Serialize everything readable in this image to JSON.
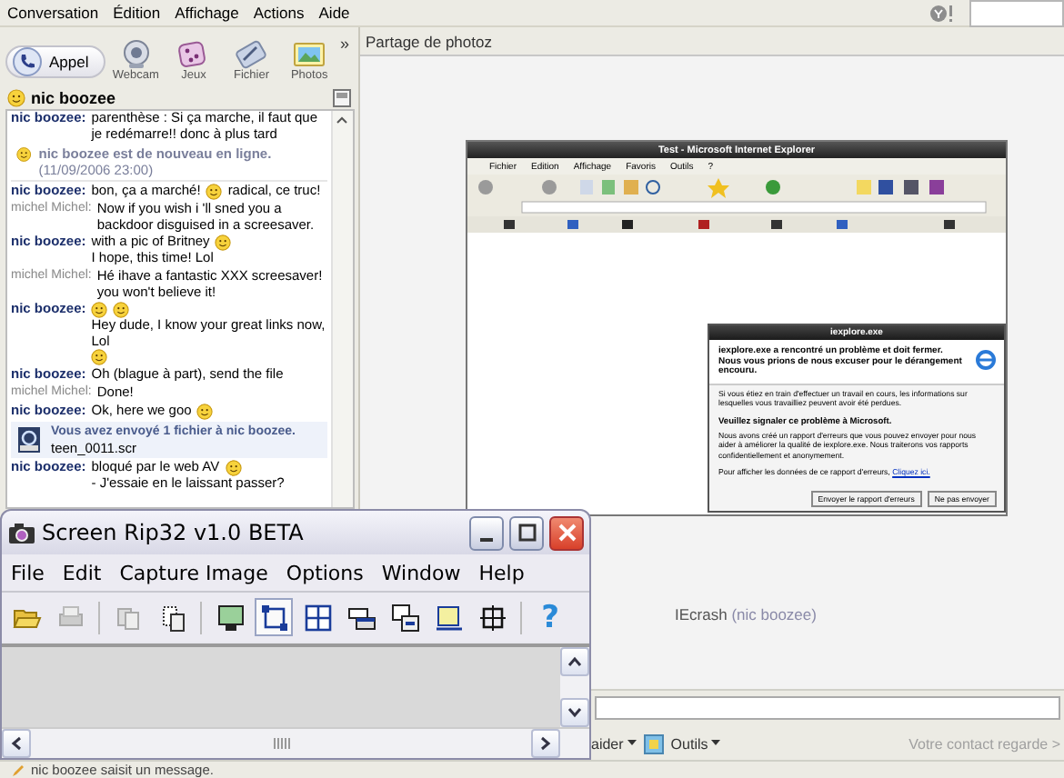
{
  "menu": [
    "Conversation",
    "Édition",
    "Affichage",
    "Actions",
    "Aide"
  ],
  "toolbar": [
    {
      "kind": "call",
      "label": "Appel"
    },
    {
      "kind": "webcam",
      "label": "Webcam"
    },
    {
      "kind": "games",
      "label": "Jeux"
    },
    {
      "kind": "file",
      "label": "Fichier"
    },
    {
      "kind": "photos",
      "label": "Photos"
    }
  ],
  "toolbar_more": "»",
  "contact": {
    "name": "nic boozee"
  },
  "chat": [
    {
      "kind": "contact",
      "sender": "nic boozee:",
      "parts": [
        {
          "kind": "text",
          "text": "parenthèse : Si ça marche, il faut que je redémarre!! donc à plus tard"
        }
      ]
    },
    {
      "kind": "status",
      "text": "nic boozee est de nouveau en ligne.",
      "time": "(11/09/2006 23:00)"
    },
    {
      "kind": "contact",
      "sender": "nic boozee:",
      "parts": [
        {
          "kind": "text",
          "text": "bon, ça a marché!"
        },
        {
          "kind": "emoticon"
        },
        {
          "kind": "text",
          "text": "radical, ce truc!"
        }
      ]
    },
    {
      "kind": "self",
      "sender": "michel Michel:",
      "parts": [
        {
          "kind": "text",
          "text": "Now if you wish i 'll sned you a backdoor disguised in a screesaver."
        }
      ]
    },
    {
      "kind": "contact",
      "sender": "nic boozee:",
      "parts": [
        {
          "kind": "text",
          "text": "with a pic of Britney"
        },
        {
          "kind": "emoticon"
        },
        {
          "kind": "text",
          "text": "I hope, this time! Lol"
        }
      ]
    },
    {
      "kind": "self",
      "sender": "michel Michel:",
      "parts": [
        {
          "kind": "text",
          "text": "Hé ihave a fantastic XXX screesaver! you won't believe it!"
        }
      ]
    },
    {
      "kind": "contact",
      "sender": "nic boozee:",
      "parts": [
        {
          "kind": "emoticon"
        },
        {
          "kind": "emoticon"
        },
        {
          "kind": "text",
          "text": "Hey dude, I know your great links now, Lol"
        },
        {
          "kind": "emoticon"
        }
      ]
    },
    {
      "kind": "contact",
      "sender": "nic boozee:",
      "parts": [
        {
          "kind": "text",
          "text": "Oh (blague à part), send the file"
        }
      ]
    },
    {
      "kind": "self",
      "sender": "michel Michel:",
      "parts": [
        {
          "kind": "text",
          "text": "Done!"
        }
      ]
    },
    {
      "kind": "contact",
      "sender": "nic boozee:",
      "parts": [
        {
          "kind": "text",
          "text": "Ok, here we goo"
        },
        {
          "kind": "emoticon"
        }
      ]
    },
    {
      "kind": "file",
      "text": "Vous avez envoyé 1 fichier à nic boozee.",
      "filename": "teen_0011.scr"
    },
    {
      "kind": "contact",
      "sender": "nic boozee:",
      "parts": [
        {
          "kind": "text",
          "text": "bloqué par le web AV"
        },
        {
          "kind": "emoticon"
        },
        {
          "kind": "text",
          "text": "- J'essaie en le laissant passer?"
        }
      ]
    }
  ],
  "sharing": {
    "title": "Partage de photoz",
    "screenshot": {
      "title": "Test - Microsoft Internet Explorer",
      "menu": [
        "Fichier",
        "Edition",
        "Affichage",
        "Favoris",
        "Outils",
        "?"
      ],
      "dialog": {
        "title": "iexplore.exe",
        "heading": "iexplore.exe a rencontré un problème et doit fermer. Nous vous prions de nous excuser pour le dérangement encouru.",
        "info": "Si vous étiez en train d'effectuer un travail en cours, les informations sur lesquelles vous travailliez peuvent avoir été perdues.",
        "subheading": "Veuillez signaler ce problème à Microsoft.",
        "body": "Nous avons créé un rapport d'erreurs que vous pouvez envoyer pour nous aider à améliorer la qualité de iexplore.exe. Nous traiterons vos rapports confidentiellement et anonymement.",
        "details": "Pour afficher les données de ce rapport d'erreurs,",
        "details_link": "Cliquez ici.",
        "buttons": [
          "Envoyer le rapport d'erreurs",
          "Ne pas envoyer"
        ]
      }
    },
    "photo": {
      "name": "IEcrash",
      "owner": "(nic boozee)"
    }
  },
  "compose": {
    "tools": [
      {
        "kind": "help",
        "label": "aider"
      },
      {
        "kind": "tools",
        "label": "Outils"
      }
    ],
    "watch_button": {
      "label": "Votre contact regarde >",
      "disabled": true
    }
  },
  "status_bar": "nic boozee saisit un message.",
  "screen_rip": {
    "title": "Screen Rip32 v1.0 BETA",
    "menu": [
      "File",
      "Edit",
      "Capture Image",
      "Options",
      "Window",
      "Help"
    ],
    "tools": [
      {
        "kind": "open",
        "selected": false
      },
      {
        "kind": "print",
        "selected": false
      },
      {
        "kind": "sep"
      },
      {
        "kind": "copy",
        "selected": false
      },
      {
        "kind": "paste",
        "selected": false
      },
      {
        "kind": "sep"
      },
      {
        "kind": "screen",
        "selected": false
      },
      {
        "kind": "region",
        "selected": true
      },
      {
        "kind": "grid",
        "selected": false
      },
      {
        "kind": "window",
        "selected": false
      },
      {
        "kind": "control",
        "selected": false
      },
      {
        "kind": "object",
        "selected": false
      },
      {
        "kind": "crop",
        "selected": false
      },
      {
        "kind": "sep"
      },
      {
        "kind": "help",
        "glyph": "?",
        "selected": false
      }
    ]
  }
}
